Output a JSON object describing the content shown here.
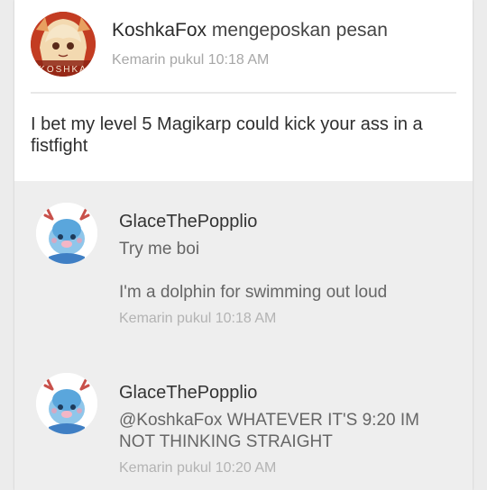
{
  "post": {
    "author": "KoshkaFox",
    "action": "mengeposkan pesan",
    "time": "Kemarin pukul 10:18 AM",
    "body": "I bet my level 5 Magikarp could kick your ass in a fistfight",
    "avatar_text": "KOSHKA"
  },
  "comments": [
    {
      "author": "GlaceThePopplio",
      "lines": [
        "Try me boi",
        "I'm a dolphin for swimming out loud"
      ],
      "time": "Kemarin pukul 10:18 AM"
    },
    {
      "author": "GlaceThePopplio",
      "lines": [
        "@KoshkaFox WHATEVER IT'S 9:20 IM NOT THINKING STRAIGHT"
      ],
      "time": "Kemarin pukul 10:20 AM"
    }
  ],
  "colors": {
    "background": "#ececec",
    "card": "#ffffff",
    "comments_bg": "#eeeeee",
    "muted_text": "#a7a7a7"
  }
}
